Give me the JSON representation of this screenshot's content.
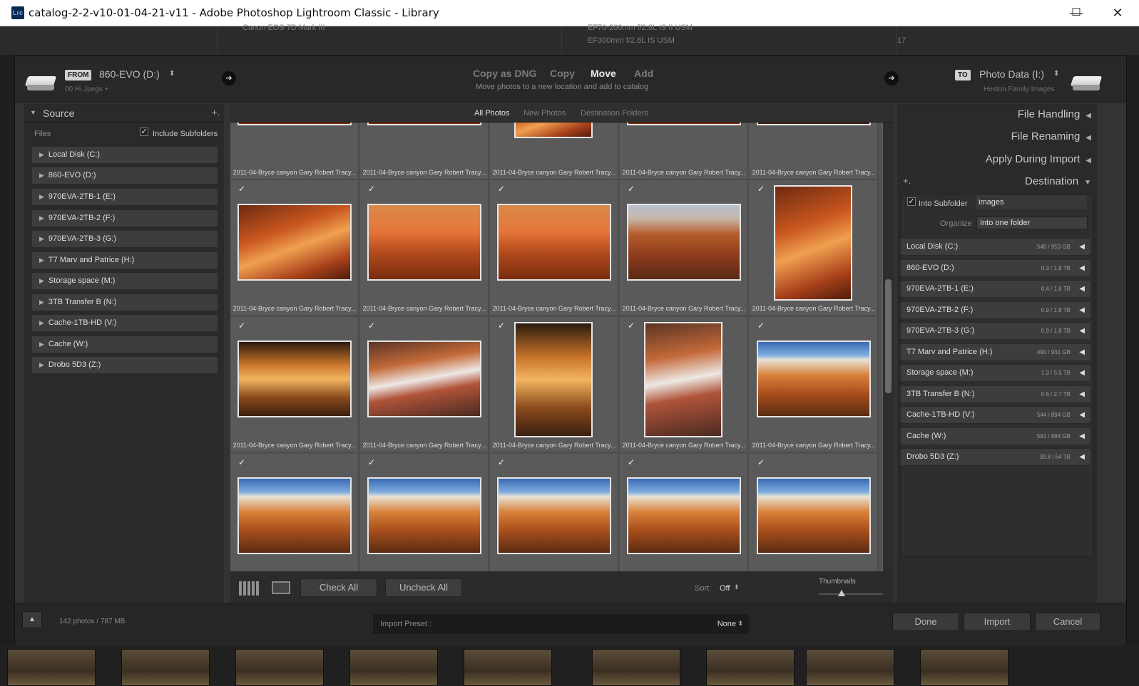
{
  "window": {
    "app_icon_text": "Lrc",
    "title": "catalog-2-2-v10-01-04-21-v11 - Adobe Photoshop Lightroom Classic - Library",
    "minimize": "—",
    "maximize": "☐",
    "close": "✕"
  },
  "background": {
    "text1": "Canon EOS 7D Mark III",
    "text2": "EF70-200mm f/2.8L IS II USM",
    "text3": "EF300mm f/2.8L IS USM",
    "count1": "17"
  },
  "header": {
    "from_badge": "FROM",
    "from_drive": "860-EVO (D:)",
    "from_path": "00 Hi Jpegs +",
    "modes": [
      "Copy as DNG",
      "Copy",
      "Move",
      "Add"
    ],
    "active_mode": "Move",
    "mode_description": "Move photos to a new location and add to catalog",
    "to_badge": "TO",
    "to_drive": "Photo Data (I:)",
    "to_path": "Heston Family Images",
    "arrow_symbol": "➔",
    "spinner_symbol": "⬍"
  },
  "source": {
    "title": "Source",
    "add_symbol": "+.",
    "files_label": "Files",
    "include_subfolders": "Include Subfolders",
    "drives": [
      "Local Disk (C:)",
      "860-EVO (D:)",
      "970EVA-2TB-1 (E:)",
      "970EVA-2TB-2 (F:)",
      "970EVA-2TB-3 (G:)",
      "T7 Marv and Patrice (H:)",
      "Storage space (M:)",
      "3TB Transfer B (N:)",
      "Cache-1TB-HD (V:)",
      "Cache (W:)",
      "Drobo 5D3 (Z:)"
    ]
  },
  "tabs": [
    "All Photos",
    "New Photos",
    "Destination Folders"
  ],
  "grid": {
    "caption": "2011-04-Bryce canyon Gary Robert Tracy...",
    "check_symbol": "✓"
  },
  "toolbar": {
    "check_all": "Check All",
    "uncheck_all": "Uncheck All",
    "sort_label": "Sort:",
    "sort_value": "Off",
    "thumbnails_label": "Thumbnails"
  },
  "right": {
    "file_handling": "File Handling",
    "file_renaming": "File Renaming",
    "apply_during_import": "Apply During Import",
    "destination": "Destination",
    "into_subfolder": "Into Subfolder",
    "subfolder_value": "images",
    "organize_label": "Organize",
    "organize_value": "Into one folder",
    "drives": [
      {
        "name": "Local Disk (C:)",
        "size": "548 / 953 GB"
      },
      {
        "name": "860-EVO (D:)",
        "size": "0.3 / 1.8 TB"
      },
      {
        "name": "970EVA-2TB-1 (E:)",
        "size": "0.4 / 1.8 TB"
      },
      {
        "name": "970EVA-2TB-2 (F:)",
        "size": "0.9 / 1.8 TB"
      },
      {
        "name": "970EVA-2TB-3 (G:)",
        "size": "0.9 / 1.8 TB"
      },
      {
        "name": "T7 Marv and Patrice (H:)",
        "size": "490 / 931 GB"
      },
      {
        "name": "Storage space (M:)",
        "size": "1.3 / 5.5 TB"
      },
      {
        "name": "3TB Transfer B (N:)",
        "size": "0.6 / 2.7 TB"
      },
      {
        "name": "Cache-1TB-HD (V:)",
        "size": "544 / 894 GB"
      },
      {
        "name": "Cache (W:)",
        "size": "581 / 894 GB"
      },
      {
        "name": "Drobo 5D3 (Z:)",
        "size": "39.8 / 64 TB"
      }
    ]
  },
  "footer": {
    "photo_count": "142 photos / 787 MB",
    "import_preset_label": "Import Preset :",
    "import_preset_value": "None",
    "done": "Done",
    "import": "Import",
    "cancel": "Cancel",
    "collapse_symbol": "▲"
  },
  "colors": {
    "accent": "#cfcfcf",
    "panel": "#2a2a2a",
    "grid": "#5a5a5a"
  }
}
